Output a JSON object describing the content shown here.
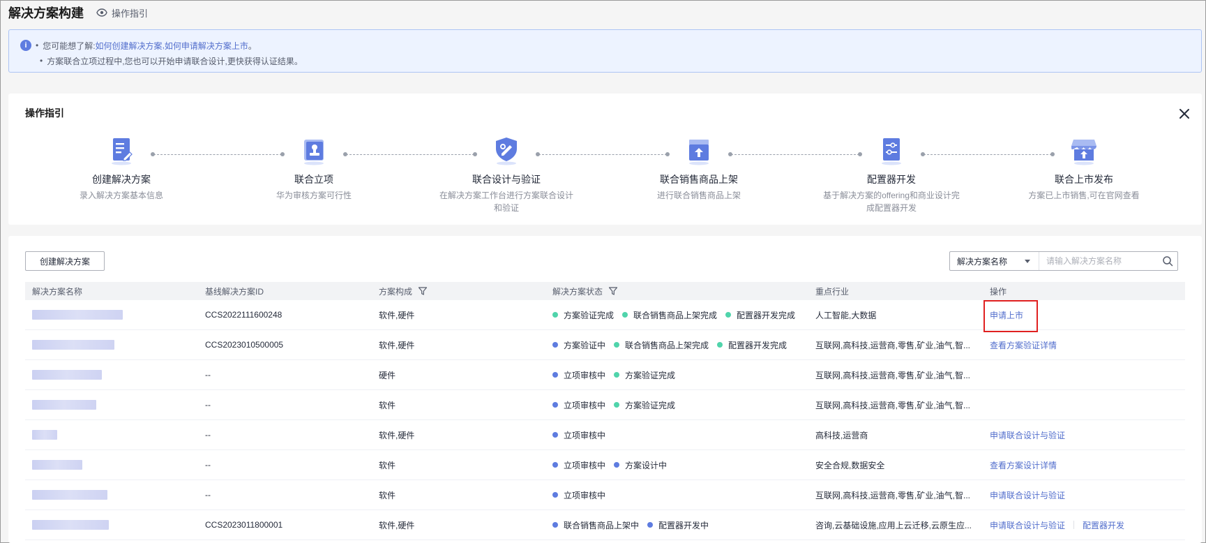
{
  "header": {
    "title": "解决方案构建",
    "guide_label": "操作指引"
  },
  "banner": {
    "line1_prefix": "您可能想了解:",
    "line1_link1": "如何创建解决方案",
    "line1_sep": ",",
    "line1_link2": "如何申请解决方案上市",
    "line1_suffix": "。",
    "line2": "方案联合立项过程中,您也可以开始申请联合设计,更快获得认证结果。"
  },
  "guide": {
    "title": "操作指引",
    "steps": [
      {
        "title": "创建解决方案",
        "desc": "录入解决方案基本信息",
        "icon": "document-edit-icon"
      },
      {
        "title": "联合立项",
        "desc": "华为审核方案可行性",
        "icon": "stamp-icon"
      },
      {
        "title": "联合设计与验证",
        "desc": "在解决方案工作台进行方案联合设计和验证",
        "icon": "shield-tools-icon"
      },
      {
        "title": "联合销售商品上架",
        "desc": "进行联合销售商品上架",
        "icon": "box-upload-icon"
      },
      {
        "title": "配置器开发",
        "desc": "基于解决方案的offering和商业设计完成配置器开发",
        "icon": "config-settings-icon"
      },
      {
        "title": "联合上市发布",
        "desc": "方案已上市销售,可在官网查看",
        "icon": "store-publish-icon"
      }
    ]
  },
  "toolbar": {
    "create_label": "创建解决方案",
    "search_field": "解决方案名称",
    "search_placeholder": "请输入解决方案名称"
  },
  "table": {
    "columns": [
      "解决方案名称",
      "基线解决方案ID",
      "方案构成",
      "解决方案状态",
      "重点行业",
      "操作"
    ],
    "rows": [
      {
        "blur_w": 130,
        "base_id": "CCS2022111600248",
        "composition": "软件,硬件",
        "statuses": [
          {
            "label": "方案验证完成",
            "color": "green"
          },
          {
            "label": "联合销售商品上架完成",
            "color": "green"
          },
          {
            "label": "配置器开发完成",
            "color": "green"
          }
        ],
        "industry": "人工智能,大数据",
        "actions": [
          "申请上市"
        ]
      },
      {
        "blur_w": 118,
        "base_id": "CCS2023010500005",
        "composition": "软件,硬件",
        "statuses": [
          {
            "label": "方案验证中",
            "color": "blue"
          },
          {
            "label": "联合销售商品上架完成",
            "color": "green"
          },
          {
            "label": "配置器开发完成",
            "color": "green"
          }
        ],
        "industry": "互联网,高科技,运营商,零售,矿业,油气,智...",
        "actions": [
          "查看方案验证详情"
        ]
      },
      {
        "blur_w": 100,
        "base_id": "--",
        "composition": "硬件",
        "statuses": [
          {
            "label": "立项审核中",
            "color": "blue"
          },
          {
            "label": "方案验证完成",
            "color": "green"
          }
        ],
        "industry": "互联网,高科技,运营商,零售,矿业,油气,智...",
        "actions": []
      },
      {
        "blur_w": 92,
        "base_id": "--",
        "composition": "软件",
        "statuses": [
          {
            "label": "立项审核中",
            "color": "blue"
          },
          {
            "label": "方案验证完成",
            "color": "green"
          }
        ],
        "industry": "互联网,高科技,运营商,零售,矿业,油气,智...",
        "actions": []
      },
      {
        "blur_w": 36,
        "base_id": "--",
        "composition": "软件,硬件",
        "statuses": [
          {
            "label": "立项审核中",
            "color": "blue"
          }
        ],
        "industry": "高科技,运营商",
        "actions": [
          "申请联合设计与验证"
        ]
      },
      {
        "blur_w": 72,
        "base_id": "--",
        "composition": "软件",
        "statuses": [
          {
            "label": "立项审核中",
            "color": "blue"
          },
          {
            "label": "方案设计中",
            "color": "blue"
          }
        ],
        "industry": "安全合规,数据安全",
        "actions": [
          "查看方案设计详情"
        ]
      },
      {
        "blur_w": 108,
        "base_id": "--",
        "composition": "软件",
        "statuses": [
          {
            "label": "立项审核中",
            "color": "blue"
          }
        ],
        "industry": "互联网,高科技,运营商,零售,矿业,油气,智...",
        "actions": [
          "申请联合设计与验证"
        ]
      },
      {
        "blur_w": 110,
        "base_id": "CCS2023011800001",
        "composition": "软件,硬件",
        "statuses": [
          {
            "label": "联合销售商品上架中",
            "color": "blue"
          },
          {
            "label": "配置器开发中",
            "color": "blue"
          }
        ],
        "industry": "咨询,云基础设施,应用上云迁移,云原生应...",
        "actions": [
          "申请联合设计与验证",
          "配置器开发"
        ]
      }
    ]
  },
  "colors": {
    "brand": "#5e7ce0",
    "link": "#526ecc",
    "success": "#50d4ab",
    "highlight": "#e02020"
  }
}
